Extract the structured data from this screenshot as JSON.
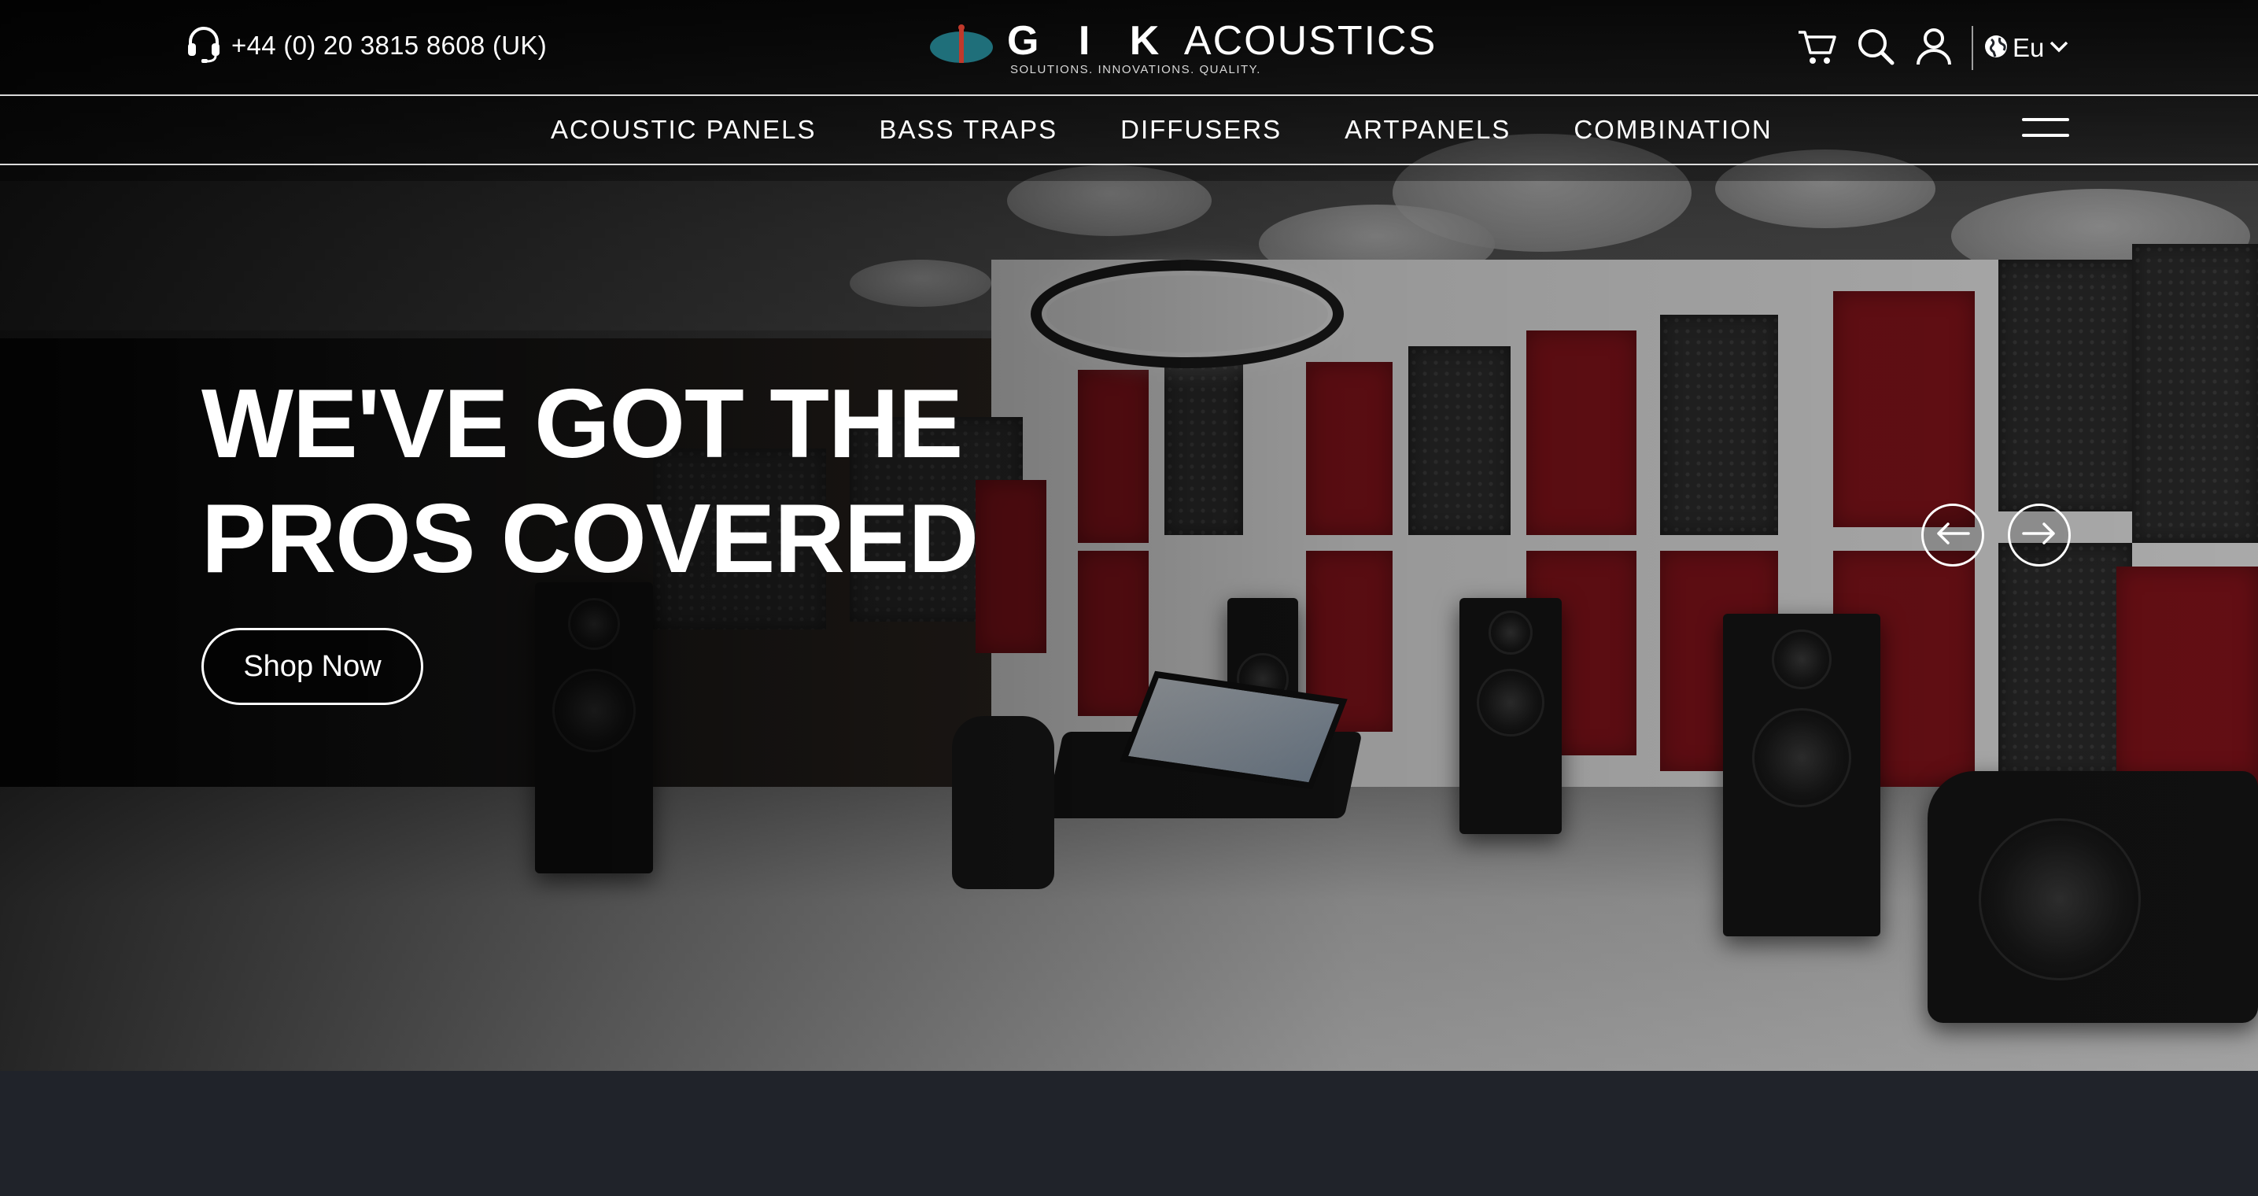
{
  "header": {
    "phone": "+44 (0) 20 3815 8608 (UK)",
    "logo": {
      "brand_bold": "G I K",
      "brand_light": "ACOUSTICS",
      "tagline": "SOLUTIONS. INNOVATIONS. QUALITY."
    },
    "tools": {
      "cart_icon": "cart-icon",
      "search_icon": "search-icon",
      "account_icon": "user-icon",
      "region_icon": "globe-icon",
      "region": "Eu"
    }
  },
  "nav": {
    "items": [
      {
        "label": "ACOUSTIC PANELS"
      },
      {
        "label": "BASS TRAPS"
      },
      {
        "label": "DIFFUSERS"
      },
      {
        "label": "ARTPANELS"
      },
      {
        "label": "COMBINATION"
      }
    ],
    "menu_icon": "hamburger-icon"
  },
  "hero": {
    "headline_line1": "WE'VE GOT THE",
    "headline_line2": "PROS COVERED",
    "cta": "Shop Now",
    "prev_icon": "arrow-left-icon",
    "next_icon": "arrow-right-icon"
  },
  "colors": {
    "text": "#ffffff",
    "logo_teal": "#1f6f7a",
    "logo_red": "#c0392b",
    "panel_red": "#7e1219",
    "footer_band": "#20232a"
  }
}
